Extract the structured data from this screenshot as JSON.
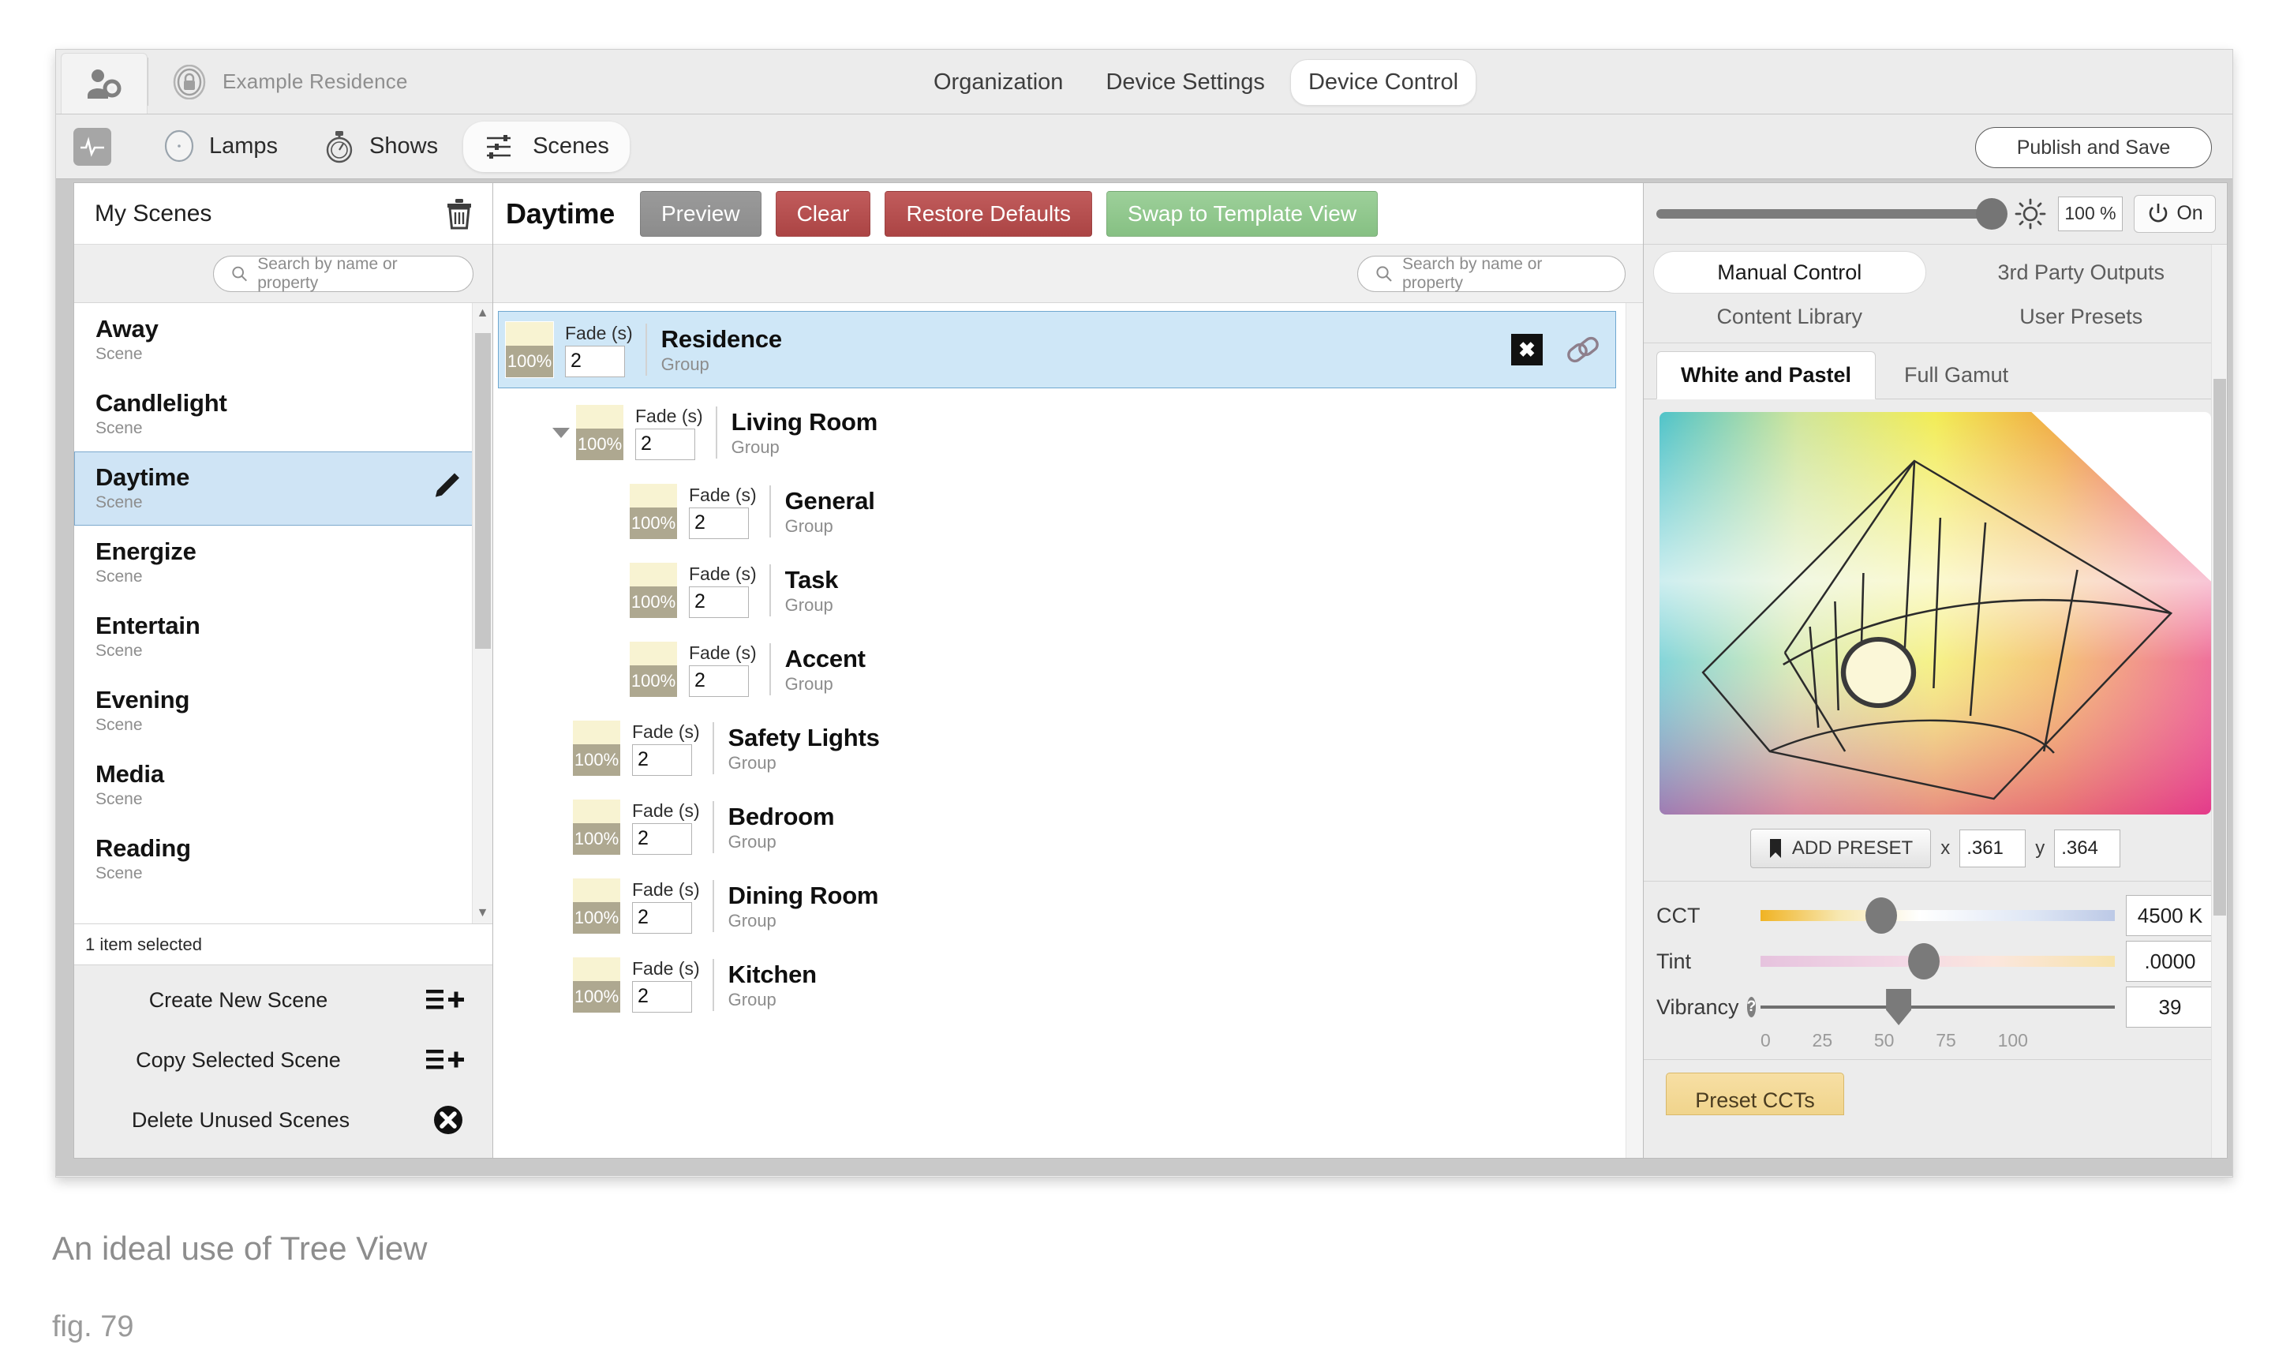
{
  "topbar": {
    "user_settings_icon": "user-gear-icon",
    "org_lock_icon": "lock-icon",
    "org_name": "Example Residence",
    "tabs": [
      {
        "label": "Organization",
        "active": false
      },
      {
        "label": "Device Settings",
        "active": false
      },
      {
        "label": "Device Control",
        "active": true
      }
    ]
  },
  "subbar": {
    "pulse_icon": "pulse-icon",
    "tabs": [
      {
        "label": "Lamps",
        "icon": "lamp-circle-icon",
        "active": false
      },
      {
        "label": "Shows",
        "icon": "stopwatch-icon",
        "active": false
      },
      {
        "label": "Scenes",
        "icon": "sliders-icon",
        "active": true
      }
    ],
    "publish_save_label": "Publish and Save"
  },
  "left_panel": {
    "title": "My Scenes",
    "delete_icon": "trash-icon",
    "search_placeholder": "Search by name or property",
    "search_value": "",
    "scenes": [
      {
        "name": "Away",
        "type": "Scene",
        "selected": false
      },
      {
        "name": "Candlelight",
        "type": "Scene",
        "selected": false
      },
      {
        "name": "Daytime",
        "type": "Scene",
        "selected": true
      },
      {
        "name": "Energize",
        "type": "Scene",
        "selected": false
      },
      {
        "name": "Entertain",
        "type": "Scene",
        "selected": false
      },
      {
        "name": "Evening",
        "type": "Scene",
        "selected": false
      },
      {
        "name": "Media",
        "type": "Scene",
        "selected": false
      },
      {
        "name": "Reading",
        "type": "Scene",
        "selected": false
      }
    ],
    "selection_status": "1 item selected",
    "actions": [
      {
        "label": "Create New Scene",
        "icon": "list-plus-icon"
      },
      {
        "label": "Copy Selected Scene",
        "icon": "list-plus-icon"
      },
      {
        "label": "Delete Unused Scenes",
        "icon": "circle-x-icon"
      }
    ]
  },
  "center_panel": {
    "scene_title": "Daytime",
    "buttons": [
      {
        "label": "Preview",
        "style": "grey"
      },
      {
        "label": "Clear",
        "style": "red"
      },
      {
        "label": "Restore Defaults",
        "style": "red"
      },
      {
        "label": "Swap to Template View",
        "style": "green"
      }
    ],
    "search_placeholder": "Search by name or property",
    "search_value": "",
    "fade_label": "Fade (s)",
    "tree": [
      {
        "name": "Residence",
        "type": "Group",
        "level": 0,
        "intensity": "100%",
        "fade": "2",
        "selected": true,
        "caret": false,
        "link_icon": "link-icon",
        "close_icon": "x-icon"
      },
      {
        "name": "Living Room",
        "type": "Group",
        "level": 1,
        "intensity": "100%",
        "fade": "2",
        "selected": false,
        "caret": true
      },
      {
        "name": "General",
        "type": "Group",
        "level": 2,
        "intensity": "100%",
        "fade": "2",
        "selected": false,
        "caret": false
      },
      {
        "name": "Task",
        "type": "Group",
        "level": 2,
        "intensity": "100%",
        "fade": "2",
        "selected": false,
        "caret": false
      },
      {
        "name": "Accent",
        "type": "Group",
        "level": 2,
        "intensity": "100%",
        "fade": "2",
        "selected": false,
        "caret": false
      },
      {
        "name": "Safety Lights",
        "type": "Group",
        "level": 1,
        "intensity": "100%",
        "fade": "2",
        "selected": false,
        "caret": false
      },
      {
        "name": "Bedroom",
        "type": "Group",
        "level": 1,
        "intensity": "100%",
        "fade": "2",
        "selected": false,
        "caret": false
      },
      {
        "name": "Dining Room",
        "type": "Group",
        "level": 1,
        "intensity": "100%",
        "fade": "2",
        "selected": false,
        "caret": false
      },
      {
        "name": "Kitchen",
        "type": "Group",
        "level": 1,
        "intensity": "100%",
        "fade": "2",
        "selected": false,
        "caret": false
      }
    ]
  },
  "right_panel": {
    "intensity": {
      "brightness_icon": "brightness-icon",
      "value": "100 %",
      "slider_percent": 100,
      "power_icon": "power-icon",
      "power_label": "On"
    },
    "mode_tabs": [
      {
        "label": "Manual Control",
        "active": true
      },
      {
        "label": "3rd Party Outputs",
        "active": false
      },
      {
        "label": "Content Library",
        "active": false
      },
      {
        "label": "User Presets",
        "active": false
      }
    ],
    "gamut_tabs": [
      {
        "label": "White and Pastel",
        "active": true
      },
      {
        "label": "Full Gamut",
        "active": false
      }
    ],
    "preset": {
      "add_preset_label": "ADD PRESET",
      "bookmark_icon": "bookmark-icon",
      "x_label": "x",
      "x_value": ".361",
      "y_label": "y",
      "y_value": ".364"
    },
    "sliders": [
      {
        "name": "CCT",
        "value": "4500 K",
        "knob_percent": 34,
        "style": "cct"
      },
      {
        "name": "Tint",
        "value": ".0000",
        "knob_percent": 46,
        "style": "tint"
      },
      {
        "name": "Vibrancy",
        "value": "39",
        "knob_percent": 39,
        "style": "plain",
        "help_icon": "help-icon"
      }
    ],
    "vibrancy_ticks": [
      "0",
      "25",
      "50",
      "75",
      "100"
    ],
    "preset_cct_label": "Preset CCTs"
  },
  "caption": {
    "title": "An ideal use of Tree View",
    "figure": "fig. 79"
  },
  "colors": {
    "selection_blue": "#cfe7f7",
    "selection_border": "#6fa8d0",
    "swatch_cream": "#f8f3d2",
    "swatch_tan": "#aea890",
    "btn_red": "#ab4444",
    "btn_green": "#86c083",
    "btn_grey": "#8c8c8c",
    "preset_cct_yellow": "#f0d48c"
  }
}
